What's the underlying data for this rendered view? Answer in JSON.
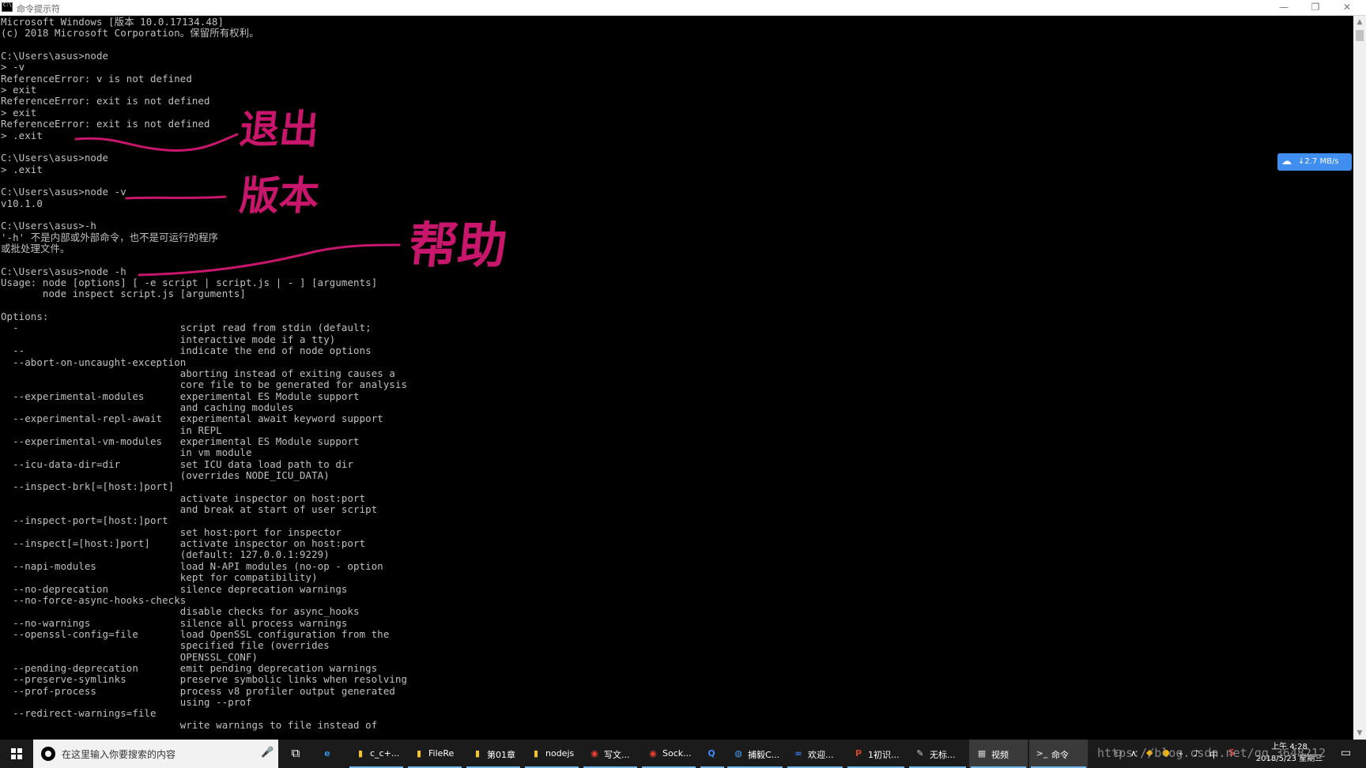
{
  "window": {
    "title": "命令提示符",
    "controls": {
      "minimize": "—",
      "maximize": "❐",
      "close": "✕"
    }
  },
  "console_lines": [
    "Microsoft Windows [版本 10.0.17134.48]",
    "(c) 2018 Microsoft Corporation。保留所有权利。",
    "",
    "C:\\Users\\asus>node",
    "> -v",
    "ReferenceError: v is not defined",
    "> exit",
    "ReferenceError: exit is not defined",
    "> exit",
    "ReferenceError: exit is not defined",
    "> .exit",
    "",
    "C:\\Users\\asus>node",
    "> .exit",
    "",
    "C:\\Users\\asus>node -v",
    "v10.1.0",
    "",
    "C:\\Users\\asus>-h",
    "'-h' 不是内部或外部命令，也不是可运行的程序",
    "或批处理文件。",
    "",
    "C:\\Users\\asus>node -h",
    "Usage: node [options] [ -e script | script.js | - ] [arguments]",
    "       node inspect script.js [arguments]",
    "",
    "Options:",
    "  -                           script read from stdin (default;",
    "                              interactive mode if a tty)",
    "  --                          indicate the end of node options",
    "  --abort-on-uncaught-exception",
    "                              aborting instead of exiting causes a",
    "                              core file to be generated for analysis",
    "  --experimental-modules      experimental ES Module support",
    "                              and caching modules",
    "  --experimental-repl-await   experimental await keyword support",
    "                              in REPL",
    "  --experimental-vm-modules   experimental ES Module support",
    "                              in vm module",
    "  --icu-data-dir=dir          set ICU data load path to dir",
    "                              (overrides NODE_ICU_DATA)",
    "  --inspect-brk[=[host:]port]",
    "                              activate inspector on host:port",
    "                              and break at start of user script",
    "  --inspect-port=[host:]port",
    "                              set host:port for inspector",
    "  --inspect[=[host:]port]     activate inspector on host:port",
    "                              (default: 127.0.0.1:9229)",
    "  --napi-modules              load N-API modules (no-op - option",
    "                              kept for compatibility)",
    "  --no-deprecation            silence deprecation warnings",
    "  --no-force-async-hooks-checks",
    "                              disable checks for async_hooks",
    "  --no-warnings               silence all process warnings",
    "  --openssl-config=file       load OpenSSL configuration from the",
    "                              specified file (overrides",
    "                              OPENSSL_CONF)",
    "  --pending-deprecation       emit pending deprecation warnings",
    "  --preserve-symlinks         preserve symbolic links when resolving",
    "  --prof-process              process v8 profiler output generated",
    "                              using --prof",
    "  --redirect-warnings=file",
    "                              write warnings to file instead of"
  ],
  "annotations": {
    "exit": "退出",
    "version": "版本",
    "help": "帮助",
    "color": "#c8166d"
  },
  "download_widget": {
    "icon": "cloud-icon",
    "speed": "↓2.7 MB/s"
  },
  "taskbar": {
    "search_placeholder": "在这里输入你要搜索的内容",
    "items": [
      {
        "icon": "edge-icon",
        "label": ""
      },
      {
        "icon": "folder-icon",
        "label": "c_c+..."
      },
      {
        "icon": "folder-icon",
        "label": "FileRe"
      },
      {
        "icon": "folder-icon",
        "label": "第01章"
      },
      {
        "icon": "folder-icon",
        "label": "nodejs"
      },
      {
        "icon": "chrome-icon",
        "label": "写文..."
      },
      {
        "icon": "chrome-icon",
        "label": "Sock..."
      },
      {
        "icon": "qq-browser-icon",
        "label": ""
      },
      {
        "icon": "globe-icon",
        "label": "捕毅C..."
      },
      {
        "icon": "baidu-netdisk-icon",
        "label": "欢迎..."
      },
      {
        "icon": "powerpoint-icon",
        "label": "1初识..."
      },
      {
        "icon": "paint-icon",
        "label": "无标..."
      },
      {
        "icon": "video-icon",
        "label": "视频"
      },
      {
        "icon": "cmd-icon",
        "label": "命令"
      }
    ],
    "tray": {
      "ime": "中",
      "clock_time": "上午 4:28",
      "clock_date": "2018/5/23 星期三"
    }
  },
  "watermark": "https://blog.csdn.net/qq_3648212"
}
